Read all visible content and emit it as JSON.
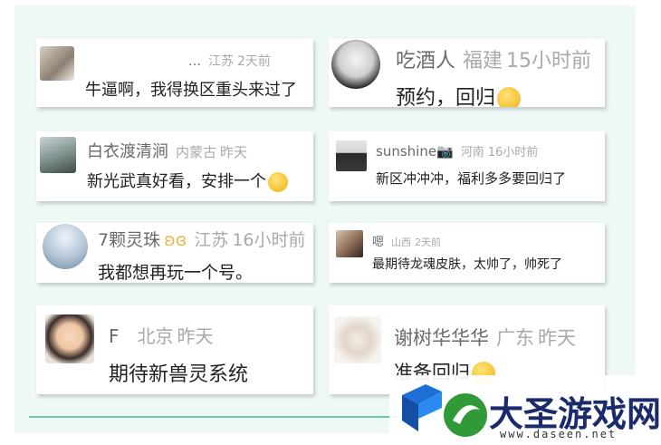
{
  "comments": [
    {
      "name": "…",
      "location": "江苏",
      "time": "2天前",
      "text": "牛逼啊，我得换区重头来过了",
      "emoji": ""
    },
    {
      "name": "吃酒人",
      "location": "福建",
      "time": "15小时前",
      "text": "预约，回归",
      "emoji": "cat-face-emoji"
    },
    {
      "name": "白衣渡清涧",
      "location": "内蒙古",
      "time": "昨天",
      "text": "新光武真好看，安排一个",
      "emoji": "smirk-emoji"
    },
    {
      "name": "sunshine📷",
      "location": "河南",
      "time": "16小时前",
      "text": "新区冲冲冲，福利多多要回归了",
      "emoji": ""
    },
    {
      "name": "7颗灵珠",
      "location": "江苏",
      "time": "16小时前",
      "text": "我都想再玩一个号。",
      "emoji": "ribbon-icon"
    },
    {
      "name": "嗯",
      "location": "山西",
      "time": "2天前",
      "text": "最期待龙魂皮肤，太帅了，帅死了",
      "emoji": ""
    },
    {
      "name": "F",
      "location": "北京",
      "time": "昨天",
      "text": "期待新兽灵系统",
      "emoji": ""
    },
    {
      "name": "谢树华华华",
      "location": "广东",
      "time": "昨天",
      "text": "准备回归",
      "emoji": "666-emoji"
    }
  ],
  "watermark": {
    "title": "大圣游戏网",
    "url": "www.daseen.net"
  },
  "colors": {
    "panel_bg": "#eef8f5",
    "accent_line": "#6ccaa8",
    "meta_gray": "#a9a9a9",
    "brand_blue": "#1b2a6b",
    "brand_green": "#3fae3a"
  }
}
